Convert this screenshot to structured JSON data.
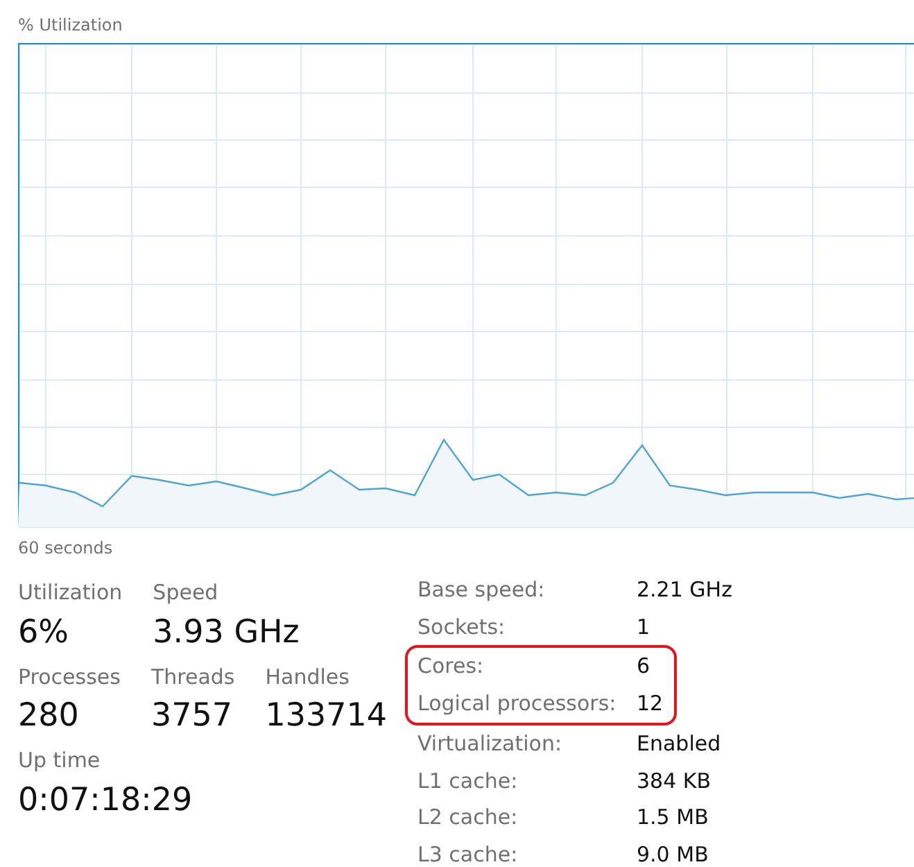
{
  "graph": {
    "title": "% Utilization",
    "time_span": "60 seconds"
  },
  "stat_rows": [
    {
      "stats": [
        {
          "label": "Utilization",
          "value": "6%"
        },
        {
          "label": "Speed",
          "value": "3.93 GHz"
        }
      ]
    },
    {
      "stats": [
        {
          "label": "Processes",
          "value": "280"
        },
        {
          "label": "Threads",
          "value": "3757"
        },
        {
          "label": "Handles",
          "value": "133714"
        }
      ]
    },
    {
      "stats": [
        {
          "label": "Up time",
          "value": "0:07:18:29"
        }
      ]
    }
  ],
  "specs": [
    {
      "label": "Base speed:",
      "value": "2.21 GHz",
      "highlighted": false
    },
    {
      "label": "Sockets:",
      "value": "1",
      "highlighted": false
    },
    {
      "label": "Cores:",
      "value": "6",
      "highlighted": true
    },
    {
      "label": "Logical processors:",
      "value": "12",
      "highlighted": true
    },
    {
      "label": "Virtualization:",
      "value": "Enabled",
      "highlighted": false
    },
    {
      "label": "L1 cache:",
      "value": "384 KB",
      "highlighted": false
    },
    {
      "label": "L2 cache:",
      "value": "1.5 MB",
      "highlighted": false
    },
    {
      "label": "L3 cache:",
      "value": "9.0 MB",
      "highlighted": false
    }
  ]
}
